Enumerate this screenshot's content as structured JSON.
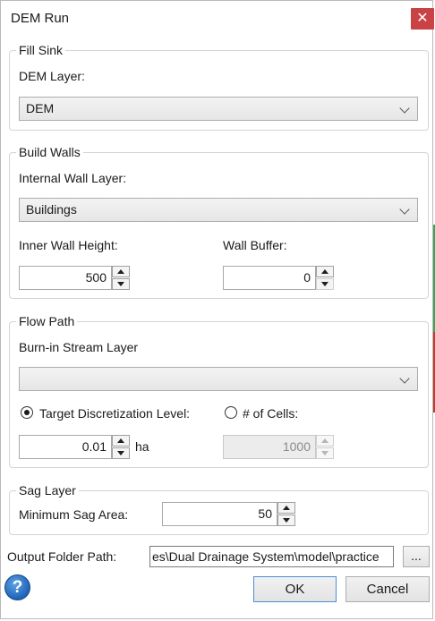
{
  "window": {
    "title": "DEM Run",
    "close_glyph": "✕"
  },
  "fill_sink": {
    "group_title": "Fill Sink",
    "dem_layer_label": "DEM Layer:",
    "dem_layer_value": "DEM"
  },
  "build_walls": {
    "group_title": "Build Walls",
    "internal_wall_label": "Internal Wall Layer:",
    "internal_wall_value": "Buildings",
    "inner_wall_height_label": "Inner Wall Height:",
    "inner_wall_height_value": "500",
    "wall_buffer_label": "Wall Buffer:",
    "wall_buffer_value": "0"
  },
  "flow_path": {
    "group_title": "Flow Path",
    "burn_in_label": "Burn-in Stream Layer",
    "burn_in_value": "",
    "target_disc_label": "Target Discretization Level:",
    "target_disc_checked": true,
    "num_cells_label": "# of Cells:",
    "num_cells_checked": false,
    "target_disc_value": "0.01",
    "target_disc_unit": "ha",
    "num_cells_value": "1000"
  },
  "sag_layer": {
    "group_title": "Sag Layer",
    "min_sag_label": "Minimum Sag Area:",
    "min_sag_value": "50"
  },
  "output": {
    "label": "Output Folder Path:",
    "value": "es\\Dual Drainage System\\model\\practice",
    "browse_label": "..."
  },
  "buttons": {
    "ok": "OK",
    "cancel": "Cancel",
    "help_glyph": "?"
  },
  "icons": {
    "close": "close-icon",
    "dropdown": "chevron-down-icon",
    "help": "help-icon"
  },
  "colors": {
    "close_bg": "#c94245",
    "help_blue": "#1e63b8",
    "ok_border": "#4a8fd6"
  }
}
